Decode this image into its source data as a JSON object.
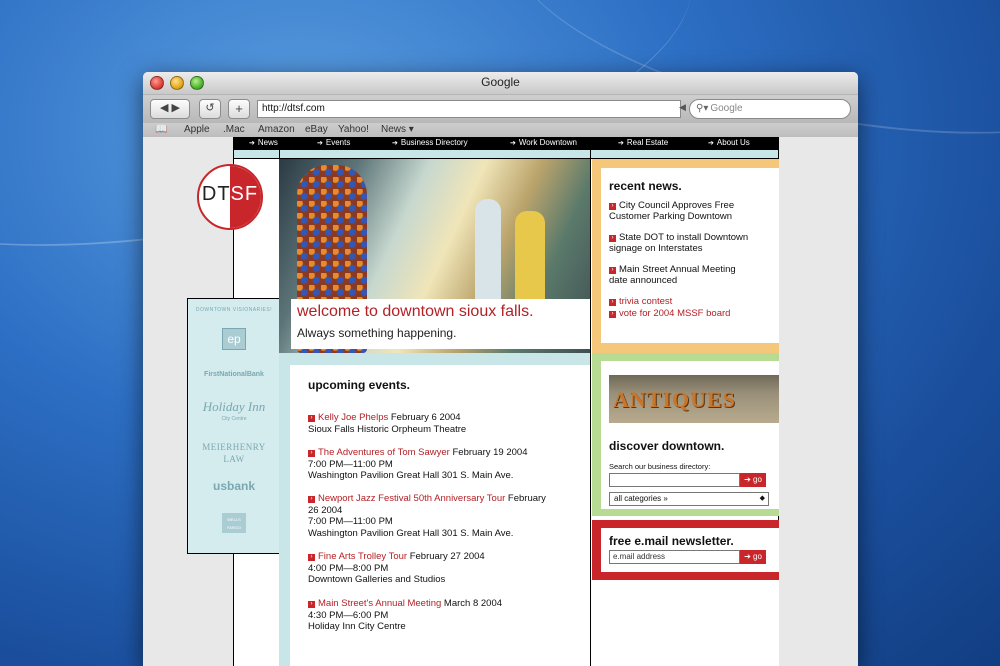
{
  "browser": {
    "title": "Google",
    "address": "http://dtsf.com",
    "search_placeholder": "Google",
    "bookmarks": [
      "Apple",
      ".Mac",
      "Amazon",
      "eBay",
      "Yahoo!",
      "News ▾"
    ]
  },
  "site": {
    "logo": {
      "left": "DT",
      "right": "SF"
    },
    "nav": [
      "News",
      "Events",
      "Business Directory",
      "Work Downtown",
      "Real Estate",
      "About Us"
    ],
    "sponsors_title": "DOWNTOWN VISIONARIES!",
    "sponsors": [
      "ep",
      "FirstNationalBank",
      "Holiday Inn",
      "City Centre",
      "MEIERHENRY",
      "LAW",
      "usbank",
      "WELLS FARGO"
    ],
    "hero": {
      "title": "welcome to downtown sioux falls.",
      "subtitle": "Always something happening."
    },
    "news": {
      "heading": "recent news.",
      "items": [
        {
          "line1": "City Council Approves Free",
          "line2": "Customer Parking Downtown"
        },
        {
          "line1": "State DOT to install Downtown",
          "line2": "signage on Interstates"
        },
        {
          "line1": "Main Street Annual Meeting",
          "line2": "date announced"
        }
      ],
      "links": [
        "trivia contest",
        "vote for 2004 MSSF board"
      ]
    },
    "events": {
      "heading": "upcoming events.",
      "items": [
        {
          "name": "Kelly Joe Phelps",
          "date": "February 6 2004",
          "time": "",
          "place": "Sioux Falls Historic Orpheum Theatre"
        },
        {
          "name": "The Adventures of Tom Sawyer",
          "date": "February 19 2004",
          "time": "7:00 PM—11:00 PM",
          "place": "Washington Pavilion Great Hall 301 S. Main Ave."
        },
        {
          "name": "Newport Jazz Festival 50th Anniversary Tour",
          "date": "February",
          "date2": "26 2004",
          "time": "7:00 PM—11:00 PM",
          "place": "Washington Pavilion Great Hall 301 S. Main Ave."
        },
        {
          "name": "Fine Arts Trolley Tour",
          "date": "February 27 2004",
          "time": "4:00 PM—8:00 PM",
          "place": "Downtown Galleries and Studios"
        },
        {
          "name": "Main Street's Annual Meeting",
          "date": "March 8 2004",
          "time": "4:30 PM—6:00 PM",
          "place": "Holiday Inn City Centre"
        }
      ]
    },
    "discover": {
      "sign": "ANTIQUES",
      "heading": "discover downtown.",
      "label": "Search our business directory:",
      "go": "go",
      "category": "all categories »"
    },
    "newsletter": {
      "heading": "free e.mail newsletter.",
      "placeholder": "e.mail address",
      "go": "go"
    }
  }
}
